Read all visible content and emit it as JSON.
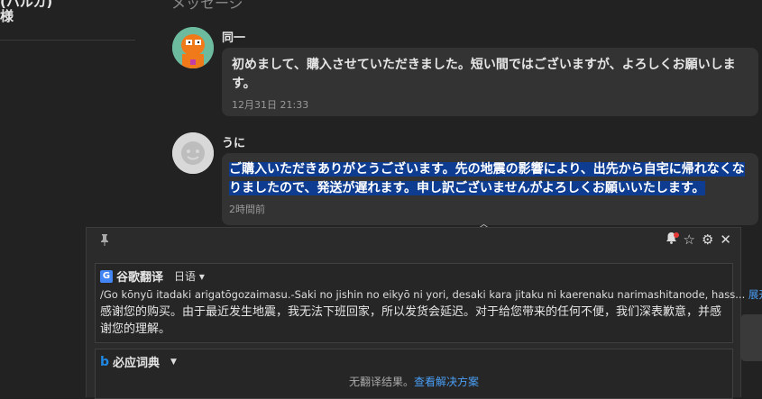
{
  "sidebar": {
    "name_line1": "(ハルカ)",
    "name_line2": "様"
  },
  "section_title": "メッセージ",
  "messages": [
    {
      "sender": "同一",
      "text": "初めまして、購入させていただきました。短い間ではございますが、よろしくお願いします。",
      "time": "12月31日 21:33"
    },
    {
      "sender": "うに",
      "text": "ご購入いただきありがとうございます。先の地震の影響により、出先から自宅に帰れなくなりましたので、発送が遅れます。申し訳ございませんがよろしくお願いいたします。",
      "time": "2時間前"
    }
  ],
  "popup": {
    "google": {
      "title": "谷歌翻译",
      "language": "日语",
      "romanization": "/Go kōnyū itadaki arigatōgozaimasu.-Saki no jishin no eikyō ni yori, desaki kara jitaku ni kaerenaku narimashitanode, hass...",
      "expand_label": "展开",
      "translation": "感谢您的购买。由于最近发生地震，我无法下班回家，所以发货会延迟。对于给您带来的任何不便，我们深表歉意，并感谢您的理解。"
    },
    "bing": {
      "title": "必应词典",
      "no_result": "无翻译结果。",
      "solution_link": "查看解决方案"
    }
  },
  "icons": [
    "pin-icon",
    "bell-icon",
    "star-icon",
    "gear-icon",
    "close-icon"
  ],
  "colors": {
    "selection": "#0d3c91",
    "link": "#4a9ff5",
    "notification": "#e53935"
  }
}
